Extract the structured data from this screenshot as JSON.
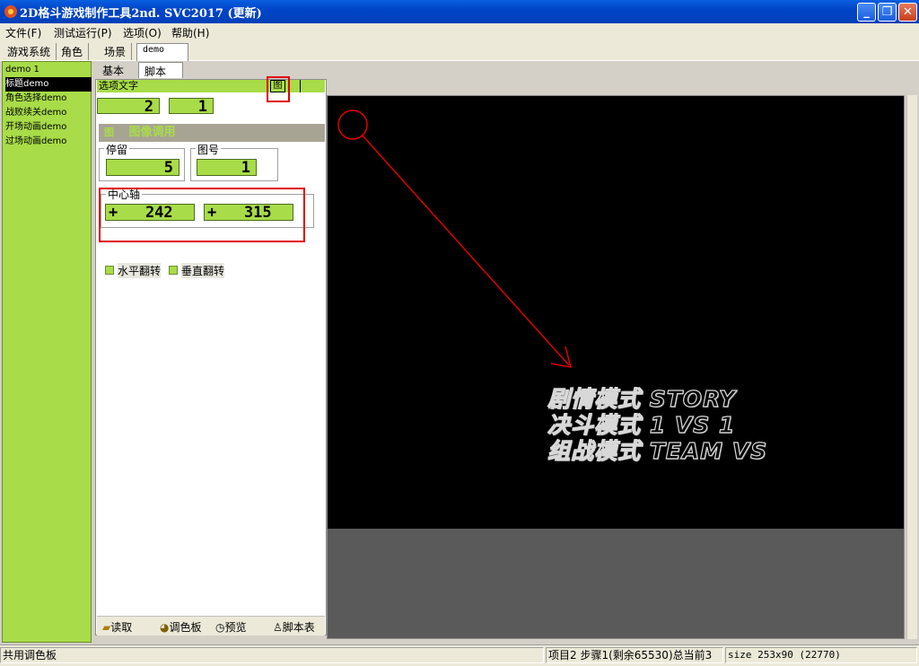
{
  "window": {
    "title": "2D格斗游戏制作工具2nd. SVC2017 (更新)",
    "controls": {
      "minimize": "_",
      "maximize": "❐",
      "close": "✕"
    }
  },
  "menu": [
    "文件(F)",
    "测试运行(P)",
    "选项(O)",
    "帮助(H)"
  ],
  "top_tabs": [
    "游戏系统",
    "角色",
    "场景",
    "demo"
  ],
  "left_list": {
    "items": [
      "demo 1",
      "标题demo",
      "角色选择demo",
      "战败续关demo",
      "开场动画demo",
      "过场动画demo"
    ],
    "selected_index": 1
  },
  "mid_tabs": [
    "基本",
    "脚本"
  ],
  "option_bar": {
    "label": "选项文字",
    "icon_glyph": "图"
  },
  "top_values": [
    "2",
    "1"
  ],
  "image_call": {
    "icon": "图",
    "title": "图像调用"
  },
  "stay": {
    "label": "停留",
    "value": "5"
  },
  "image_no": {
    "label": "图号",
    "value": "1"
  },
  "center_axis": {
    "label": "中心轴",
    "x": "+   242",
    "y": "+   315"
  },
  "flips": {
    "horizontal": "水平翻转",
    "vertical": "垂直翻转"
  },
  "bottom_tools": [
    "读取",
    "调色板",
    "预览",
    "脚本表"
  ],
  "preview_text": [
    "剧情模式 STORY",
    "决斗模式 1 VS 1",
    "组战模式 TEAM VS"
  ],
  "status": {
    "left": "共用调色板",
    "middle": "项目2 步骤1(剩余65530)总当前3",
    "right": "size 253x90 (22770)"
  },
  "colors": {
    "accent_green": "#a8dc48",
    "annotation_red": "#e00000",
    "titlebar_blue": "#0a5fe0"
  }
}
